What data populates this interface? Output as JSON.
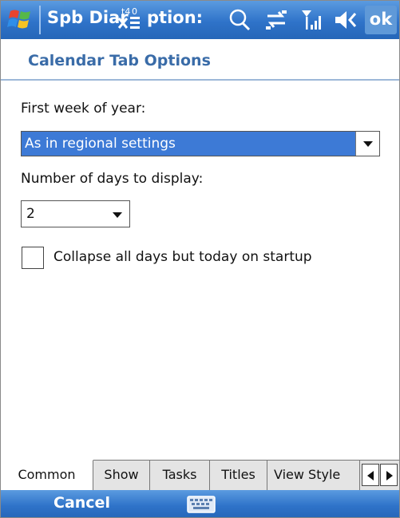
{
  "titlebar": {
    "app_title_part1": "Spb Diar",
    "app_title_part2": "ption:",
    "ok_label": "ok"
  },
  "header": {
    "title": "Calendar Tab Options"
  },
  "form": {
    "first_week_label": "First week of year:",
    "first_week_value": "As in regional settings",
    "days_label": "Number of days to display:",
    "days_value": "2",
    "collapse_label": "Collapse all days but today on startup",
    "collapse_checked": false
  },
  "tabs": [
    {
      "label": "Common",
      "active": true
    },
    {
      "label": "Show",
      "active": false
    },
    {
      "label": "Tasks",
      "active": false
    },
    {
      "label": "Titles",
      "active": false
    },
    {
      "label": "View Style",
      "active": false
    }
  ],
  "softkeys": {
    "left": "Cancel"
  },
  "icons": {
    "start": "windows-flag-icon",
    "search": "search-icon",
    "connectivity": "connectivity-icon",
    "signal": "signal-icon",
    "volume": "volume-icon",
    "keyboard": "keyboard-icon"
  },
  "colors": {
    "titlebar": "#2f73c9",
    "header_text": "#3a6ca8",
    "selection": "#3d7ad6"
  }
}
